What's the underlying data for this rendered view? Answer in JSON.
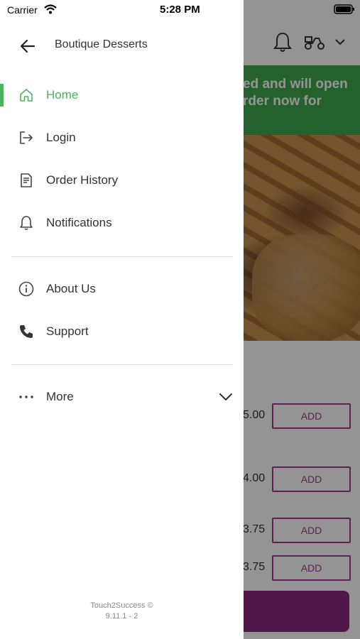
{
  "status_bar": {
    "carrier": "Carrier",
    "time": "5:28 PM"
  },
  "drawer": {
    "title": "Boutique Desserts",
    "items": [
      {
        "label": "Home",
        "icon": "home-icon",
        "active": true
      },
      {
        "label": "Login",
        "icon": "login-icon"
      },
      {
        "label": "Order History",
        "icon": "receipt-icon"
      },
      {
        "label": "Notifications",
        "icon": "bell-icon"
      },
      {
        "label": "About Us",
        "icon": "info-icon"
      },
      {
        "label": "Support",
        "icon": "phone-icon"
      },
      {
        "label": "More",
        "icon": "more-dots-icon"
      }
    ],
    "footer_line1": "Touch2Success ©",
    "footer_line2": "9.11.1 - 2"
  },
  "background": {
    "banner_line1": "ed and will open",
    "banner_line2": "rder now for",
    "items": [
      {
        "price": "5.00",
        "add_label": "ADD"
      },
      {
        "price": "4.00",
        "add_label": "ADD"
      },
      {
        "price": "3.75",
        "add_label": "ADD"
      },
      {
        "price": "3.75",
        "add_label": "ADD"
      }
    ]
  },
  "colors": {
    "accent_green": "#4db35e",
    "banner_green": "#3fa84f",
    "brand_purple": "#a03c8e"
  }
}
